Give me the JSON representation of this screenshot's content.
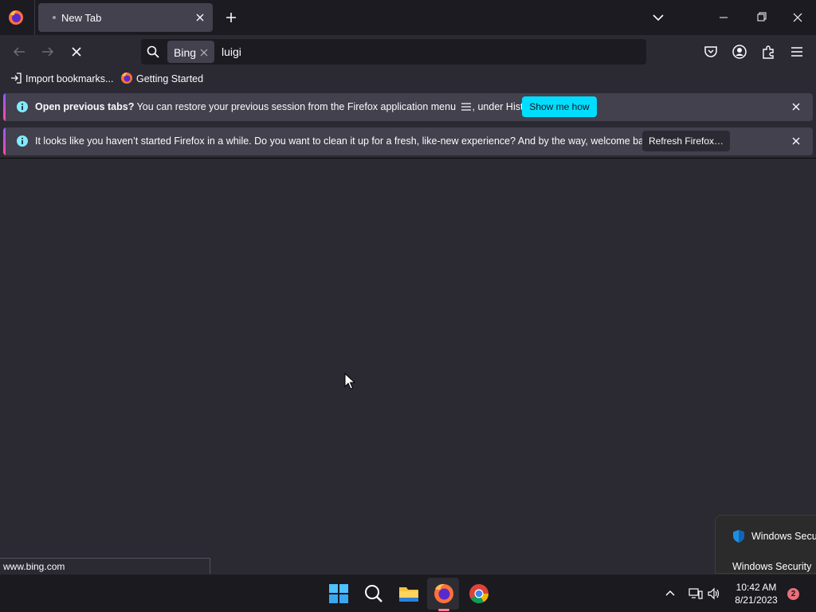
{
  "window": {
    "tab_title": "New Tab"
  },
  "urlbar": {
    "engine": "Bing",
    "query": "luigi"
  },
  "bookmarks": [
    {
      "label": "Import bookmarks..."
    },
    {
      "label": "Getting Started"
    }
  ],
  "infobars": {
    "session": {
      "bold": "Open previous tabs?",
      "text_before_icon": "You can restore your previous session from the Firefox application menu",
      "text_after_icon": ", under History.",
      "button": "Show me how"
    },
    "refresh": {
      "text": "It looks like you haven’t started Firefox in a while. Do you want to clean it up for a fresh, like-new experience? And by the way, welcome back!",
      "button": "Refresh Firefox…"
    }
  },
  "status": {
    "url": "www.bing.com"
  },
  "toast": {
    "title": "Windows Security",
    "subtitle": "Windows Security"
  },
  "taskbar": {
    "time": "10:42 AM",
    "date": "8/21/2023",
    "notifications": "2"
  },
  "colors": {
    "accent_cyan": "#00ddff",
    "chrome_dark": "#1c1b22",
    "surface": "#2b2a33",
    "infobar": "#42414d"
  }
}
